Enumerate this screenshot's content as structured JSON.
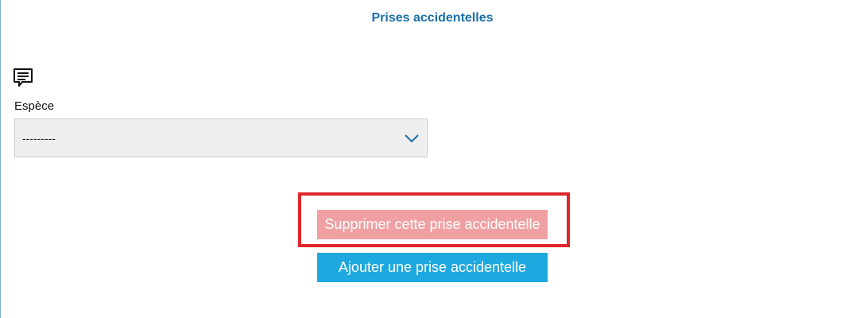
{
  "section": {
    "title": "Prises accidentelles"
  },
  "form": {
    "species_label": "Espèce",
    "species_select": {
      "selected": "---------"
    }
  },
  "actions": {
    "delete_label": "Supprimer cette prise accidentelle",
    "add_label": "Ajouter une prise accidentelle"
  },
  "colors": {
    "title": "#1a6fa8",
    "delete_button": "#f0a0a2",
    "add_button": "#1ea8e0",
    "highlight": "#e0262b"
  },
  "icons": {
    "comment": "comment-icon",
    "chevron": "chevron-down-icon"
  }
}
